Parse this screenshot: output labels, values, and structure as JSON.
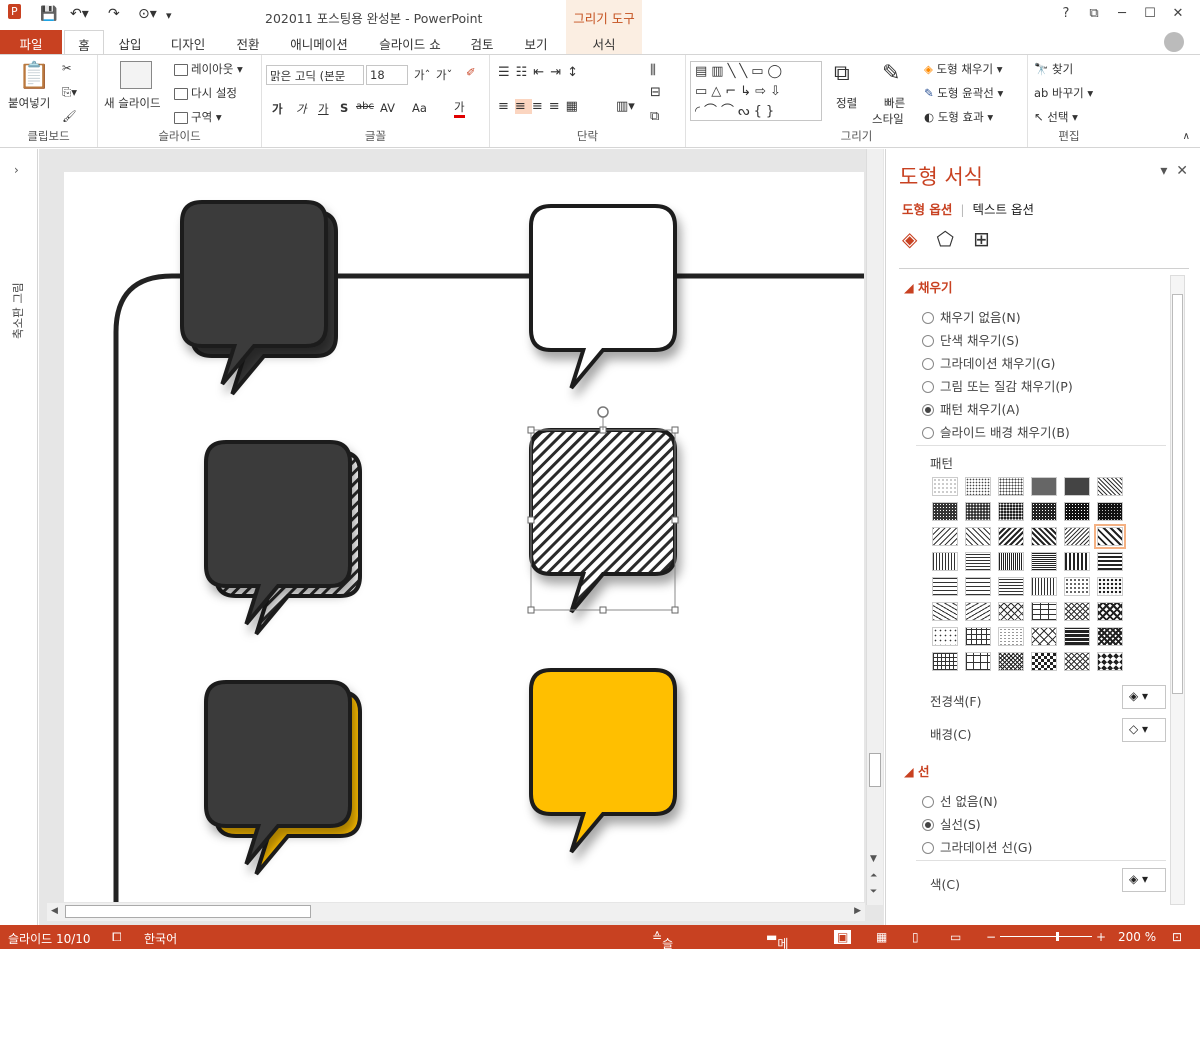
{
  "window": {
    "title": "202011 포스팅용 완성본 - PowerPoint",
    "context_tool": "그리기 도구",
    "controls": [
      "?",
      "⧉",
      "─",
      "☐",
      "✕"
    ]
  },
  "tabs": [
    {
      "label": "파일"
    },
    {
      "label": "홈"
    },
    {
      "label": "삽입"
    },
    {
      "label": "디자인"
    },
    {
      "label": "전환"
    },
    {
      "label": "애니메이션"
    },
    {
      "label": "슬라이드 쇼"
    },
    {
      "label": "검토"
    },
    {
      "label": "보기"
    },
    {
      "label": "서식"
    }
  ],
  "ribbon": {
    "clipboard": {
      "label": "클립보드",
      "paste": "붙여넣기"
    },
    "slides": {
      "label": "슬라이드",
      "new_slide": "새 슬라이드",
      "layout": "레이아웃",
      "reset": "다시 설정",
      "section": "구역"
    },
    "font": {
      "label": "글꼴",
      "font_name": "맑은 고딕 (본문",
      "font_size": "18",
      "bold": "가",
      "italic": "가",
      "underline": "가",
      "shadow": "S",
      "strike": "abc",
      "spacing": "AV",
      "case": "Aa",
      "color": "가"
    },
    "paragraph": {
      "label": "단락"
    },
    "drawing": {
      "label": "그리기",
      "arrange": "정렬",
      "quick_styles": "빠른",
      "quick_styles2": "스타일",
      "fill": "도형 채우기",
      "outline": "도형 윤곽선",
      "effects": "도형 효과"
    },
    "editing": {
      "label": "편집",
      "find": "찾기",
      "replace": "바꾸기",
      "select": "선택"
    }
  },
  "left_strip": {
    "label": "축소판 그림"
  },
  "slide": {
    "bubbles": [
      {
        "fill": "#3a3a3a",
        "style": "offset-shadow"
      },
      {
        "fill": "#ffffff",
        "style": "plain"
      },
      {
        "fill": "#3a3a3a",
        "style": "hatched-shadow"
      },
      {
        "fill": "#ffffff",
        "style": "hatched-selected"
      },
      {
        "fill": "#3a3a3a",
        "style": "yellow-shadow"
      },
      {
        "fill": "#ffbf00",
        "style": "plain"
      }
    ]
  },
  "format_pane": {
    "title": "도형 서식",
    "tab_shape": "도형 옵션",
    "tab_text": "텍스트 옵션",
    "fill_section": "채우기",
    "fill_options": [
      {
        "label": "채우기 없음(N)",
        "selected": false
      },
      {
        "label": "단색 채우기(S)",
        "selected": false
      },
      {
        "label": "그라데이션 채우기(G)",
        "selected": false
      },
      {
        "label": "그림 또는 질감 채우기(P)",
        "selected": false
      },
      {
        "label": "패턴 채우기(A)",
        "selected": true
      },
      {
        "label": "슬라이드 배경 채우기(B)",
        "selected": false
      }
    ],
    "pattern_label": "패턴",
    "foreground": "전경색(F)",
    "background": "배경(C)",
    "line_section": "선",
    "line_options": [
      {
        "label": "선 없음(N)",
        "selected": false
      },
      {
        "label": "실선(S)",
        "selected": true
      },
      {
        "label": "그라데이션 선(G)",
        "selected": false
      }
    ],
    "line_color": "색(C)"
  },
  "status": {
    "slide": "슬라이드 10/10",
    "lang": "한국어",
    "notes": "슬라이드 노트",
    "comments": "메모",
    "zoom": "200 %"
  },
  "colors": {
    "accent": "#c84121",
    "dark": "#3a3a3a",
    "yellow": "#ffbf00"
  }
}
